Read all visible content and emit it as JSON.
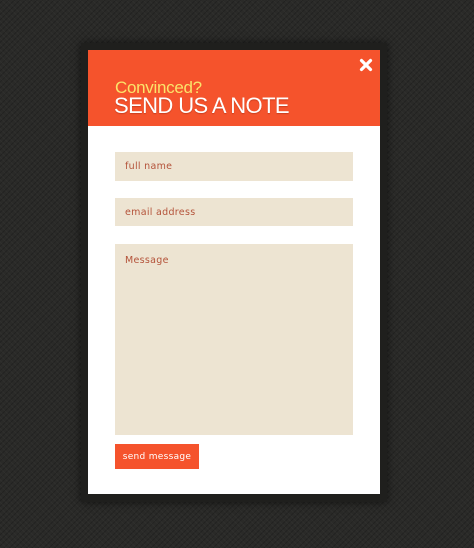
{
  "modal": {
    "kicker": "Convinced?",
    "title": "SEND US A NOTE",
    "close_icon": "close-icon"
  },
  "form": {
    "name_placeholder": "full name",
    "email_placeholder": "email address",
    "message_placeholder": "Message",
    "submit_label": "send message"
  },
  "colors": {
    "accent": "#f5532c",
    "kicker": "#fbe36a",
    "field_background": "#ede4d2",
    "field_text": "#b4533a",
    "page_background": "#2a2a28"
  }
}
